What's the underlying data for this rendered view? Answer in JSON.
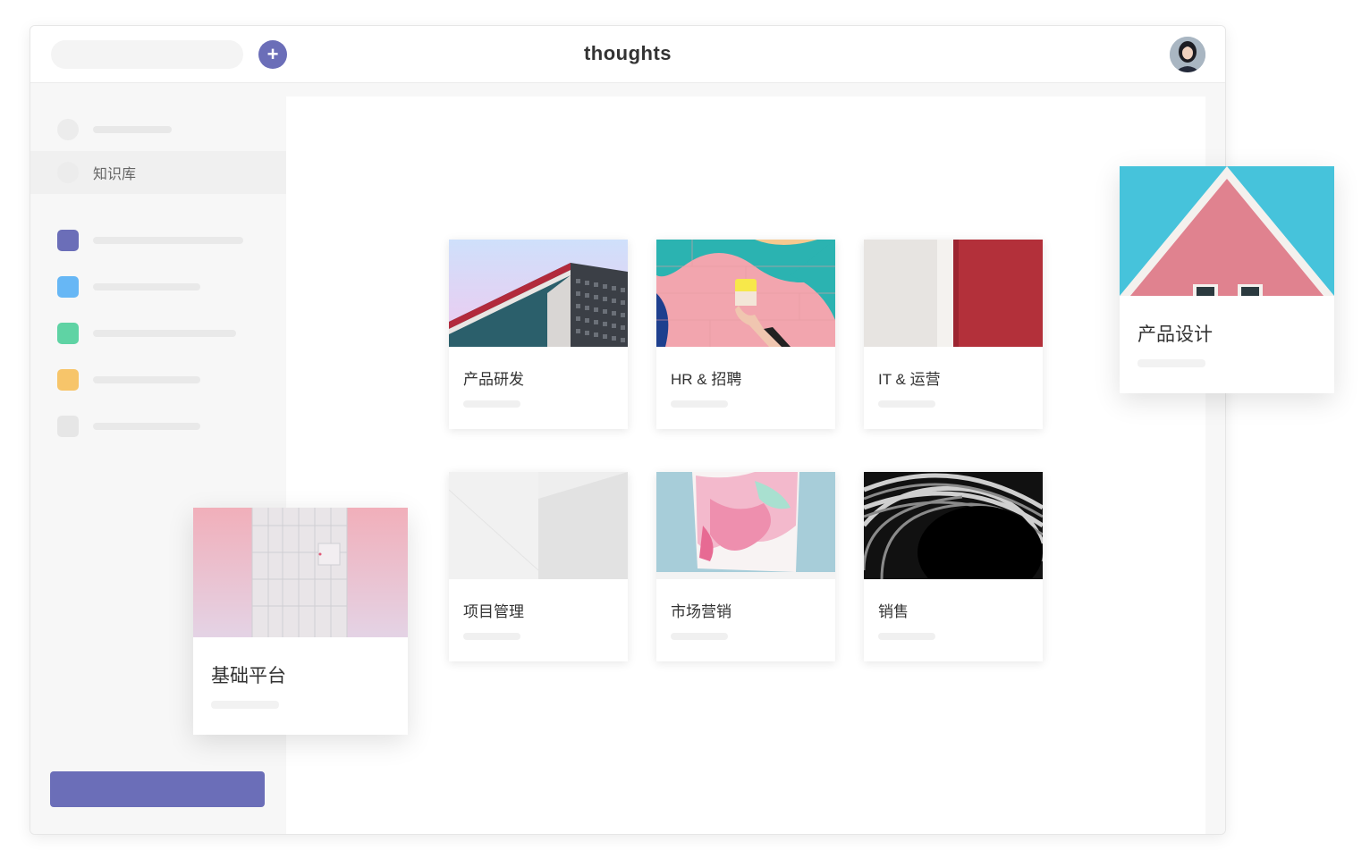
{
  "header": {
    "title": "thoughts",
    "add_label": "+"
  },
  "sidebar": {
    "nav_items": [
      {
        "label": ""
      },
      {
        "label": "知识库",
        "active": true
      }
    ],
    "spaces": [
      {
        "color": "#6b6eb8"
      },
      {
        "color": "#67b7f5"
      },
      {
        "color": "#5fd3a4"
      },
      {
        "color": "#f7c56a"
      },
      {
        "color": "#e6e6e6"
      }
    ]
  },
  "main": {
    "cards": [
      {
        "title": "产品研发",
        "image": "architecture-corner"
      },
      {
        "title": "HR & 招聘",
        "image": "colorful-wall-hand"
      },
      {
        "title": "IT & 运营",
        "image": "red-white-wall"
      },
      {
        "title": "项目管理",
        "image": "white-wall-abstract"
      },
      {
        "title": "市场营销",
        "image": "pink-poster"
      },
      {
        "title": "销售",
        "image": "black-white-spiral"
      }
    ]
  },
  "floating_cards": [
    {
      "title": "产品设计",
      "image": "pink-house-roof"
    },
    {
      "title": "基础平台",
      "image": "pink-building"
    }
  ],
  "colors": {
    "accent": "#6b6eb8"
  }
}
